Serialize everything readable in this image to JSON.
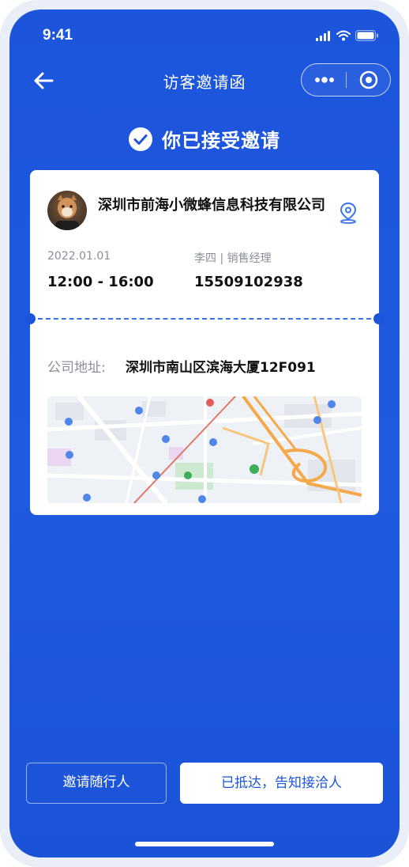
{
  "status_bar": {
    "time": "9:41"
  },
  "nav": {
    "title": "访客邀请函"
  },
  "accepted": {
    "text": "你已接受邀请"
  },
  "invitation": {
    "company": "深圳市前海小微蜂信息科技有限公司",
    "date": "2022.01.01",
    "time_range": "12:00 - 16:00",
    "contact": "李四 | 销售经理",
    "phone": "15509102938",
    "address_label": "公司地址:",
    "address": "深圳市南山区滨海大厦12F091"
  },
  "buttons": {
    "invite": "邀请随行人",
    "arrived": "已抵达，告知接洽人"
  },
  "colors": {
    "primary": "#1c55dc",
    "text_dark": "#111111",
    "text_muted": "#8a8f99",
    "route": "#f5a94a"
  },
  "icons": [
    "back-arrow-icon",
    "more-dots-icon",
    "target-close-icon",
    "check-circle-icon",
    "location-pin-icon",
    "signal-icon",
    "wifi-icon",
    "battery-icon"
  ]
}
